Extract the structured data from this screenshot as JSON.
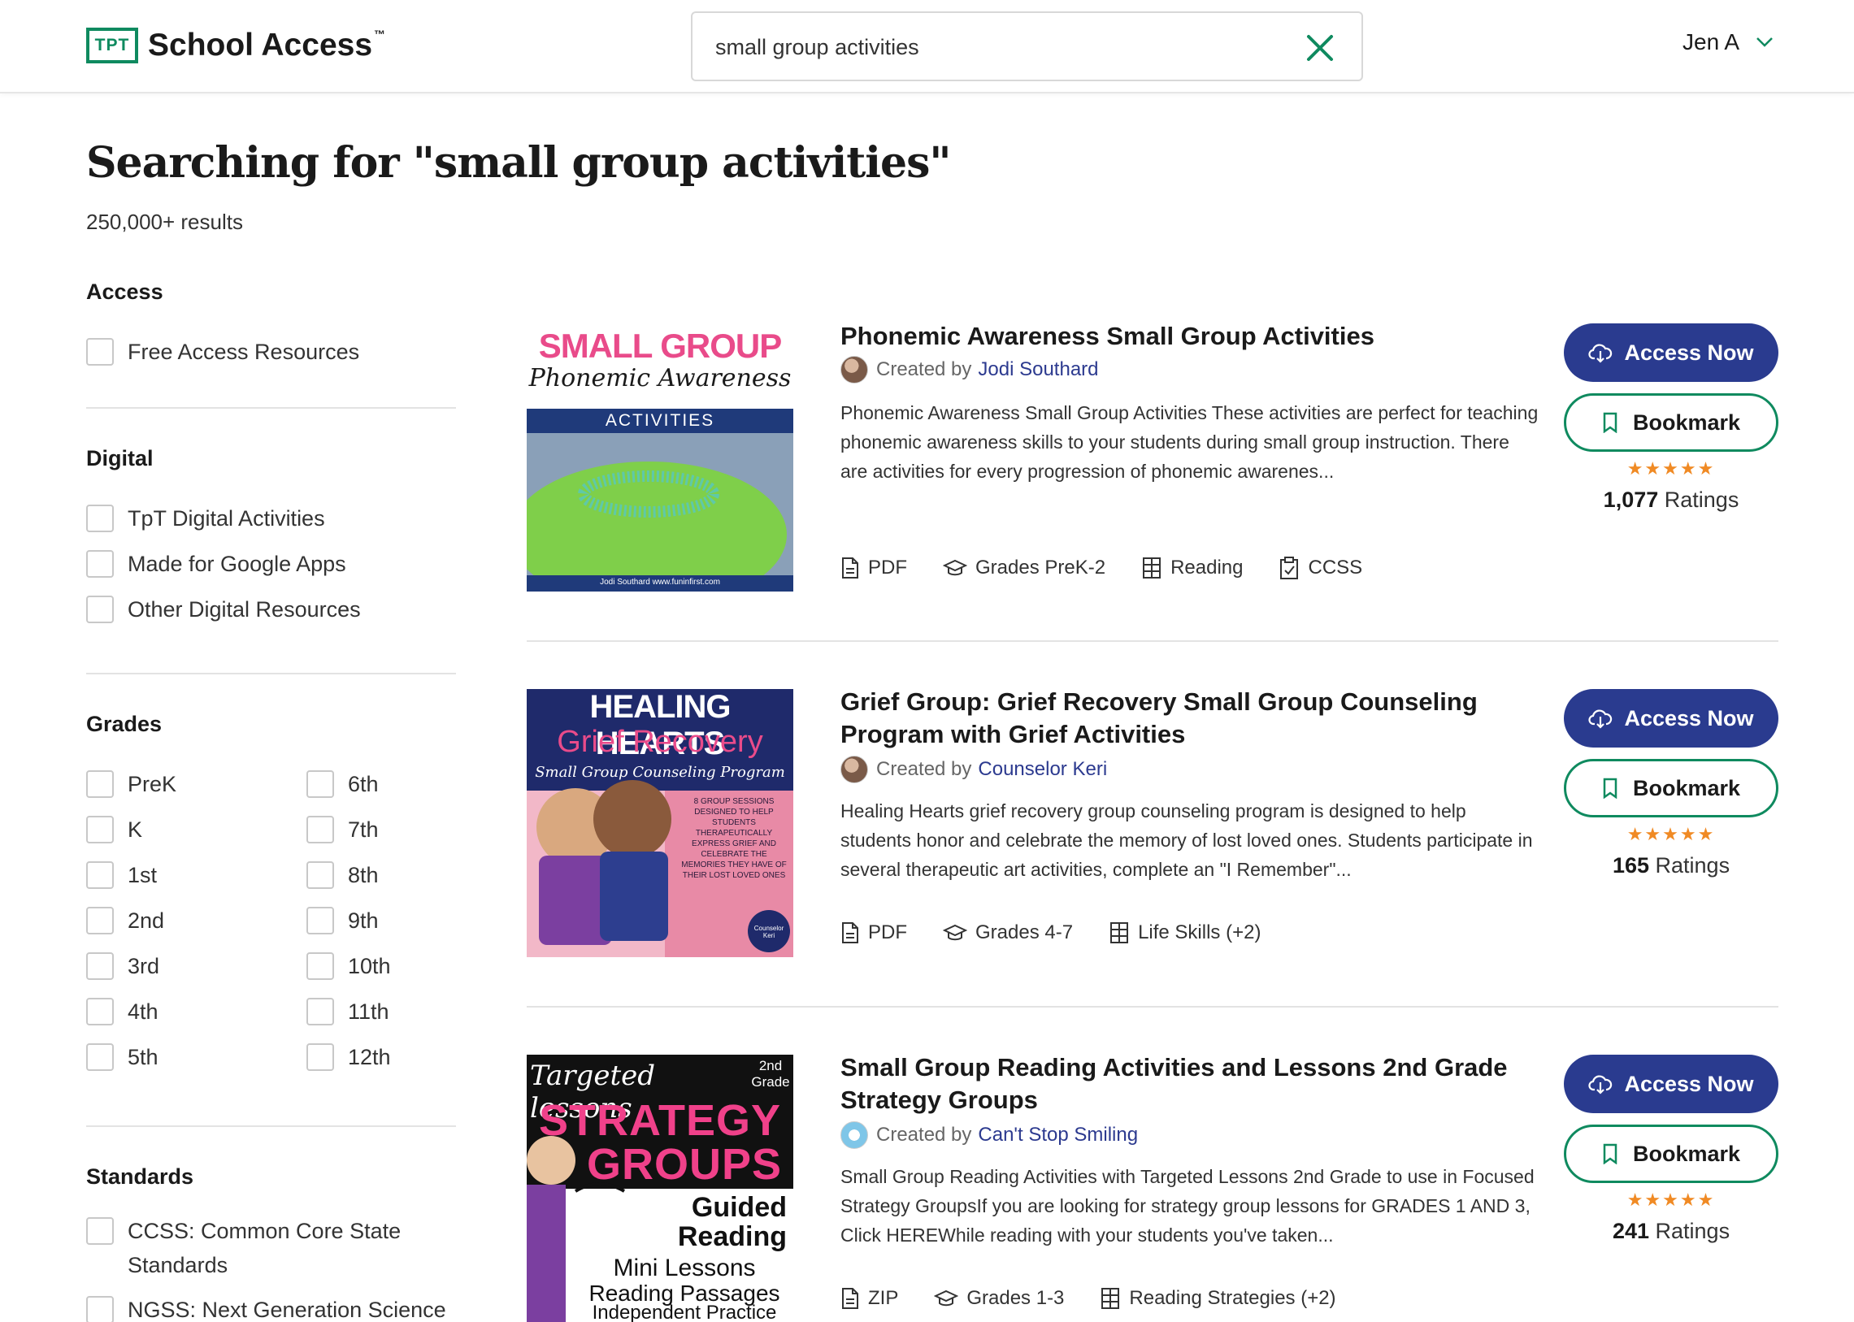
{
  "header": {
    "logo_box": "TPT",
    "logo_text": "School Access",
    "logo_tm": "™",
    "search_value": "small group activities",
    "user_name": "Jen A"
  },
  "page": {
    "title": "Searching for \"small group activities\"",
    "result_count": "250,000+ results"
  },
  "filters": {
    "access": {
      "title": "Access",
      "items": [
        "Free Access Resources"
      ]
    },
    "digital": {
      "title": "Digital",
      "items": [
        "TpT Digital Activities",
        "Made for Google Apps",
        "Other Digital Resources"
      ]
    },
    "grades": {
      "title": "Grades",
      "left": [
        "PreK",
        "K",
        "1st",
        "2nd",
        "3rd",
        "4th",
        "5th"
      ],
      "right": [
        "6th",
        "7th",
        "8th",
        "9th",
        "10th",
        "11th",
        "12th"
      ]
    },
    "standards": {
      "title": "Standards",
      "items": [
        "CCSS: Common Core State Standards",
        "NGSS: Next Generation Science"
      ]
    }
  },
  "results": [
    {
      "title": "Phonemic Awareness Small Group Activities",
      "created_by": "Created by",
      "author": "Jodi Southard",
      "description": "Phonemic Awareness Small Group Activities These activities are perfect for teaching phonemic awareness skills to your students during small group instruction. There are activities for every progression of phonemic awarenes...",
      "meta": [
        "PDF",
        "Grades PreK-2",
        "Reading",
        "CCSS"
      ],
      "access_label": "Access Now",
      "bookmark_label": "Bookmark",
      "stars": "★★★★★",
      "rating_count": "1,077",
      "rating_word": "Ratings",
      "thumb": {
        "l1": "SMALL GROUP",
        "l2": "Phonemic Awareness",
        "l3": "ACTIVITIES",
        "footer": "Jodi Southard   www.funinfirst.com"
      }
    },
    {
      "title": "Grief Group: Grief Recovery Small Group Counseling Program with Grief Activities",
      "created_by": "Created by",
      "author": "Counselor Keri",
      "description": "Healing Hearts grief recovery group counseling program is designed to help students honor and celebrate the memory of lost loved ones. Students participate in several therapeutic art activities, complete an \"I Remember\"...",
      "meta": [
        "PDF",
        "Grades 4-7",
        "Life Skills (+2)"
      ],
      "access_label": "Access Now",
      "bookmark_label": "Bookmark",
      "stars": "★★★★★",
      "rating_count": "165",
      "rating_word": "Ratings",
      "thumb": {
        "l1": "HEALING HEARTS",
        "l2": "Grief Recovery",
        "l3": "Small Group Counseling Program",
        "side": "8 GROUP SESSIONS DESIGNED TO HELP STUDENTS THERAPEUTICALLY EXPRESS GRIEF AND CELEBRATE THE MEMORIES THEY HAVE OF THEIR LOST LOVED ONES",
        "badge": "Counselor Keri"
      }
    },
    {
      "title": "Small Group Reading Activities and Lessons 2nd Grade Strategy Groups",
      "created_by": "Created by",
      "author": "Can't Stop Smiling",
      "description": "Small Group Reading Activities with Targeted Lessons 2nd Grade to use in Focused Strategy GroupsIf you are looking for strategy group lessons for GRADES 1 AND 3, Click HEREWhile reading with your students you've taken...",
      "meta": [
        "ZIP",
        "Grades 1-3",
        "Reading Strategies (+2)"
      ],
      "access_label": "Access Now",
      "bookmark_label": "Bookmark",
      "stars": "★★★★★",
      "rating_count": "241",
      "rating_word": "Ratings",
      "thumb": {
        "l1": "Targeted lessons",
        "grade": "2nd Grade",
        "l2": "STRATEGY",
        "l3": "GROUPS",
        "l4": "Guided Reading",
        "l5": "Mini Lessons",
        "l6": "Reading Passages",
        "l7": "Independent Practice"
      }
    }
  ]
}
